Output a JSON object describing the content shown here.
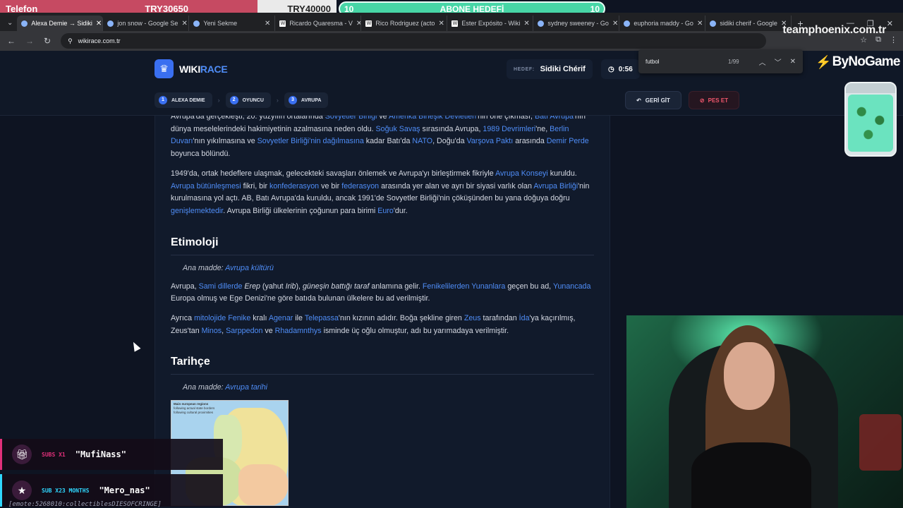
{
  "overlay": {
    "phone_label": "Telefon",
    "phone_amount": "TRY30650",
    "try_amount": "TRY40000",
    "goal_left": "10",
    "goal_title": "ABONE HEDEFİ",
    "goal_right": "10",
    "brand": "teamphoenix.com.tr",
    "sponsor": "ByNoGame"
  },
  "browser": {
    "tabs": [
      {
        "label": "Alexa Demie → Sidiki",
        "favicon": "wikirace-icon",
        "active": true
      },
      {
        "label": "jon snow - Google Se",
        "favicon": "google-icon"
      },
      {
        "label": "Yeni Sekme",
        "favicon": "chrome-icon"
      },
      {
        "label": "Ricardo Quaresma - V",
        "favicon": "wikipedia-icon"
      },
      {
        "label": "Rico Rodriguez (acto",
        "favicon": "wikipedia-icon"
      },
      {
        "label": "Ester Expósito - Wiki",
        "favicon": "wikipedia-icon"
      },
      {
        "label": "sydney sweeney - Go",
        "favicon": "google-icon"
      },
      {
        "label": "euphoria maddy - Go",
        "favicon": "google-icon"
      },
      {
        "label": "sidiki cherif - Google",
        "favicon": "google-icon"
      }
    ],
    "url": "wikirace.com.tr"
  },
  "find": {
    "query": "futbol",
    "count": "1/99"
  },
  "game": {
    "logo_a": "WIKI",
    "logo_b": "RACE",
    "target_label": "HEDEF:",
    "target_value": "Sidiki Chérif",
    "timer": "0:56",
    "path": [
      {
        "n": "1",
        "label": "ALEXA DEMIE"
      },
      {
        "n": "2",
        "label": "OYUNCU"
      },
      {
        "n": "3",
        "label": "AVRUPA"
      }
    ],
    "back_label": "GERİ GİT",
    "quit_label": "PES ET"
  },
  "article": {
    "p1": [
      {
        "t": "Avrupa'da gerçekleşti, 20. yüzyılın ortalarında "
      },
      {
        "t": "Sovyetler Birliği",
        "link": true
      },
      {
        "t": " ve "
      },
      {
        "t": "Amerika Birleşik Devletleri",
        "link": true
      },
      {
        "t": "'nin öne çıkması, "
      },
      {
        "t": "Batı Avrupa",
        "link": true
      },
      {
        "t": "'nın dünya meselelerindeki hakimiyetinin azalmasına neden oldu. "
      },
      {
        "t": "Soğuk Savaş",
        "link": true
      },
      {
        "t": " sırasında Avrupa, "
      },
      {
        "t": "1989 Devrimleri",
        "link": true
      },
      {
        "t": "'ne, "
      },
      {
        "t": "Berlin Duvarı",
        "link": true
      },
      {
        "t": "'nın yıkılmasına ve "
      },
      {
        "t": "Sovyetler Birliği'nin dağılmasına",
        "link": true
      },
      {
        "t": " kadar Batı'da "
      },
      {
        "t": "NATO",
        "link": true
      },
      {
        "t": ", Doğu'da "
      },
      {
        "t": "Varşova Paktı",
        "link": true
      },
      {
        "t": " arasında "
      },
      {
        "t": "Demir Perde",
        "link": true
      },
      {
        "t": " boyunca bölündü."
      }
    ],
    "p2": [
      {
        "t": "1949'da, ortak hedeflere ulaşmak, gelecekteki savaşları önlemek ve Avrupa'yı birleştirmek fikriyle "
      },
      {
        "t": "Avrupa Konseyi",
        "link": true
      },
      {
        "t": " kuruldu. "
      },
      {
        "t": "Avrupa bütünleşmesi",
        "link": true
      },
      {
        "t": " fikri, bir "
      },
      {
        "t": "konfederasyon",
        "link": true
      },
      {
        "t": " ve bir "
      },
      {
        "t": "federasyon",
        "link": true
      },
      {
        "t": " arasında yer alan ve ayrı bir siyasi varlık olan "
      },
      {
        "t": "Avrupa Birliği",
        "link": true
      },
      {
        "t": "'nin kurulmasına yol açtı. AB, Batı Avrupa'da kuruldu, ancak 1991'de Sovyetler Birliği'nin çöküşünden bu yana doğuya doğru "
      },
      {
        "t": "genişlemektedir",
        "link": true
      },
      {
        "t": ". Avrupa Birliği ülkelerinin çoğunun para birimi "
      },
      {
        "t": "Euro",
        "link": true
      },
      {
        "t": "'dur."
      }
    ],
    "h_etimoloji": "Etimoloji",
    "main1_prefix": "Ana madde: ",
    "main1_link": "Avrupa kültürü",
    "p3": [
      {
        "t": "Avrupa, "
      },
      {
        "t": "Sami dillerde",
        "link": true
      },
      {
        "t": " "
      },
      {
        "t": "Erep",
        "em": true
      },
      {
        "t": " (yahut "
      },
      {
        "t": "Irib",
        "em": true
      },
      {
        "t": "), "
      },
      {
        "t": "güneşin battığı taraf",
        "em": true
      },
      {
        "t": " anlamına gelir. "
      },
      {
        "t": "Fenikelilerden",
        "link": true
      },
      {
        "t": " "
      },
      {
        "t": "Yunanlara",
        "link": true
      },
      {
        "t": " geçen bu ad, "
      },
      {
        "t": "Yunancada",
        "link": true
      },
      {
        "t": " Europa olmuş ve Ege Denizi'ne göre batıda bulunan ülkelere bu ad verilmiştir."
      }
    ],
    "p4": [
      {
        "t": "Ayrıca "
      },
      {
        "t": "mitolojide",
        "link": true
      },
      {
        "t": " "
      },
      {
        "t": "Fenike",
        "link": true
      },
      {
        "t": " kralı "
      },
      {
        "t": "Agenar",
        "link": true
      },
      {
        "t": " ile "
      },
      {
        "t": "Telepassa",
        "link": true
      },
      {
        "t": "'nın kızının adıdır. Boğa şekline giren "
      },
      {
        "t": "Zeus",
        "link": true
      },
      {
        "t": " tarafından "
      },
      {
        "t": "İda",
        "link": true
      },
      {
        "t": "'ya kaçırılmış, Zeus'tan "
      },
      {
        "t": "Minos",
        "link": true
      },
      {
        "t": ", "
      },
      {
        "t": "Sarppedon",
        "link": true
      },
      {
        "t": " ve "
      },
      {
        "t": "Rhadamnthys",
        "link": true
      },
      {
        "t": " isminde üç oğlu olmuştur, adı bu yarımadaya verilmiştir."
      }
    ],
    "h_tarihce": "Tarihçe",
    "main2_prefix": "Ana madde: ",
    "main2_link": "Avrupa tarihi",
    "map_legend": [
      "Main european regions",
      "following actual state borders",
      "following cultural proximities"
    ]
  },
  "alerts": [
    {
      "tag": "SUBS X1",
      "name": "\"MufiNass\"",
      "icon": "gift-icon"
    },
    {
      "tag": "SUB X23 MONTHS",
      "name": "\"Mero_nas\"",
      "icon": "star-icon"
    }
  ],
  "emote_text": "[emote:5268010:collectiblesDIESOFCRINGE]",
  "colors": {
    "accent": "#3a6ff0",
    "link": "#4f8df7",
    "quit": "#f0566c",
    "goal": "#47d6a6"
  }
}
